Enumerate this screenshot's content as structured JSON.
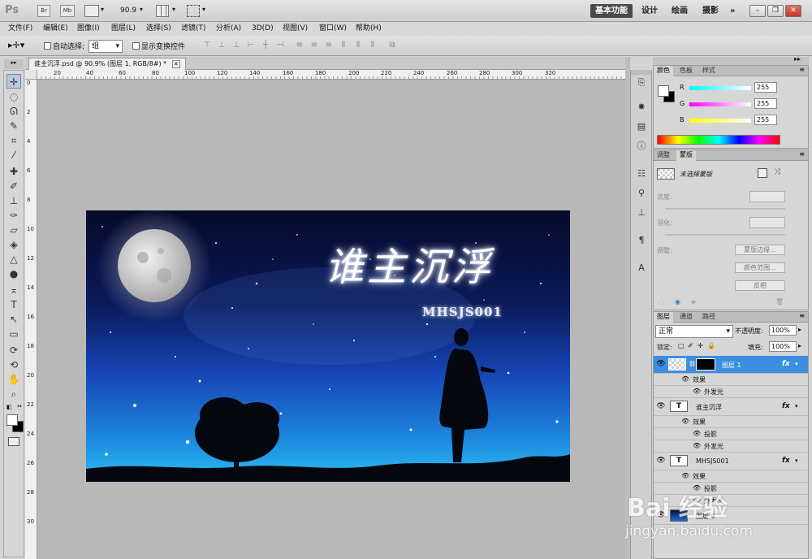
{
  "app": {
    "logo": "Ps",
    "top_buttons": [
      "Br",
      "Mb"
    ],
    "zoom": "90.9",
    "workspaces": [
      "基本功能",
      "设计",
      "绘画",
      "摄影"
    ],
    "more_glyph": "»",
    "window_controls": [
      "–",
      "❐",
      "✕"
    ]
  },
  "menu": [
    "文件(F)",
    "编辑(E)",
    "图像(I)",
    "图层(L)",
    "选择(S)",
    "滤镜(T)",
    "分析(A)",
    "3D(D)",
    "视图(V)",
    "窗口(W)",
    "帮助(H)"
  ],
  "options_bar": {
    "auto_select_label": "自动选择:",
    "auto_select_value": "组",
    "show_transform_label": "显示变换控件"
  },
  "document": {
    "tab_title": "谁主沉浮.psd @ 90.9% (图层 1, RGB/8#) *",
    "ruler_top_labels": [
      "20",
      "40",
      "60",
      "80",
      "100",
      "120",
      "140",
      "160",
      "180",
      "200",
      "220",
      "240",
      "260",
      "280",
      "300",
      "320"
    ],
    "ruler_left_labels": [
      "0",
      "2",
      "4",
      "6",
      "8",
      "10",
      "12",
      "14",
      "16",
      "18",
      "20",
      "22",
      "24",
      "26",
      "28",
      "30"
    ],
    "image_title_text": "谁主沉浮",
    "image_subtitle_text": "MHSJS001"
  },
  "color_panel": {
    "tabs": [
      "颜色",
      "色板",
      "样式"
    ],
    "channels": [
      {
        "label": "R",
        "value": "255"
      },
      {
        "label": "G",
        "value": "255"
      },
      {
        "label": "B",
        "value": "255"
      }
    ]
  },
  "masks_panel": {
    "tabs": [
      "调整",
      "蒙版"
    ],
    "no_mask_label": "未选择蒙版",
    "density_label": "浓度:",
    "feather_label": "羽化:",
    "refine_label": "调整:",
    "buttons": [
      "蒙版边缘...",
      "颜色范围...",
      "反相"
    ]
  },
  "layers_panel": {
    "tabs": [
      "图层",
      "通道",
      "路径"
    ],
    "blend_mode": "正常",
    "opacity_label": "不透明度:",
    "opacity_value": "100%",
    "lock_label": "锁定:",
    "fill_label": "填充:",
    "fill_value": "100%",
    "layers": [
      {
        "name": "图层 1",
        "effects_label": "效果",
        "effects": [
          "外发光"
        ],
        "selected": true
      },
      {
        "name": "谁主沉浮",
        "effects_label": "效果",
        "effects": [
          "投影",
          "外发光"
        ],
        "selected": false
      },
      {
        "name": "MHSJS001",
        "effects_label": "效果",
        "effects": [
          "投影",
          "外发光"
        ],
        "selected": false
      },
      {
        "name": "图层 0",
        "effects_label": "",
        "effects": [],
        "selected": false
      }
    ]
  },
  "watermark": {
    "line1": "Bai 经验",
    "line2": "jingyan.baidu.com"
  },
  "colors": {
    "selection_blue": "#3b8ee0",
    "workspace_active": "#4a4a4a"
  }
}
